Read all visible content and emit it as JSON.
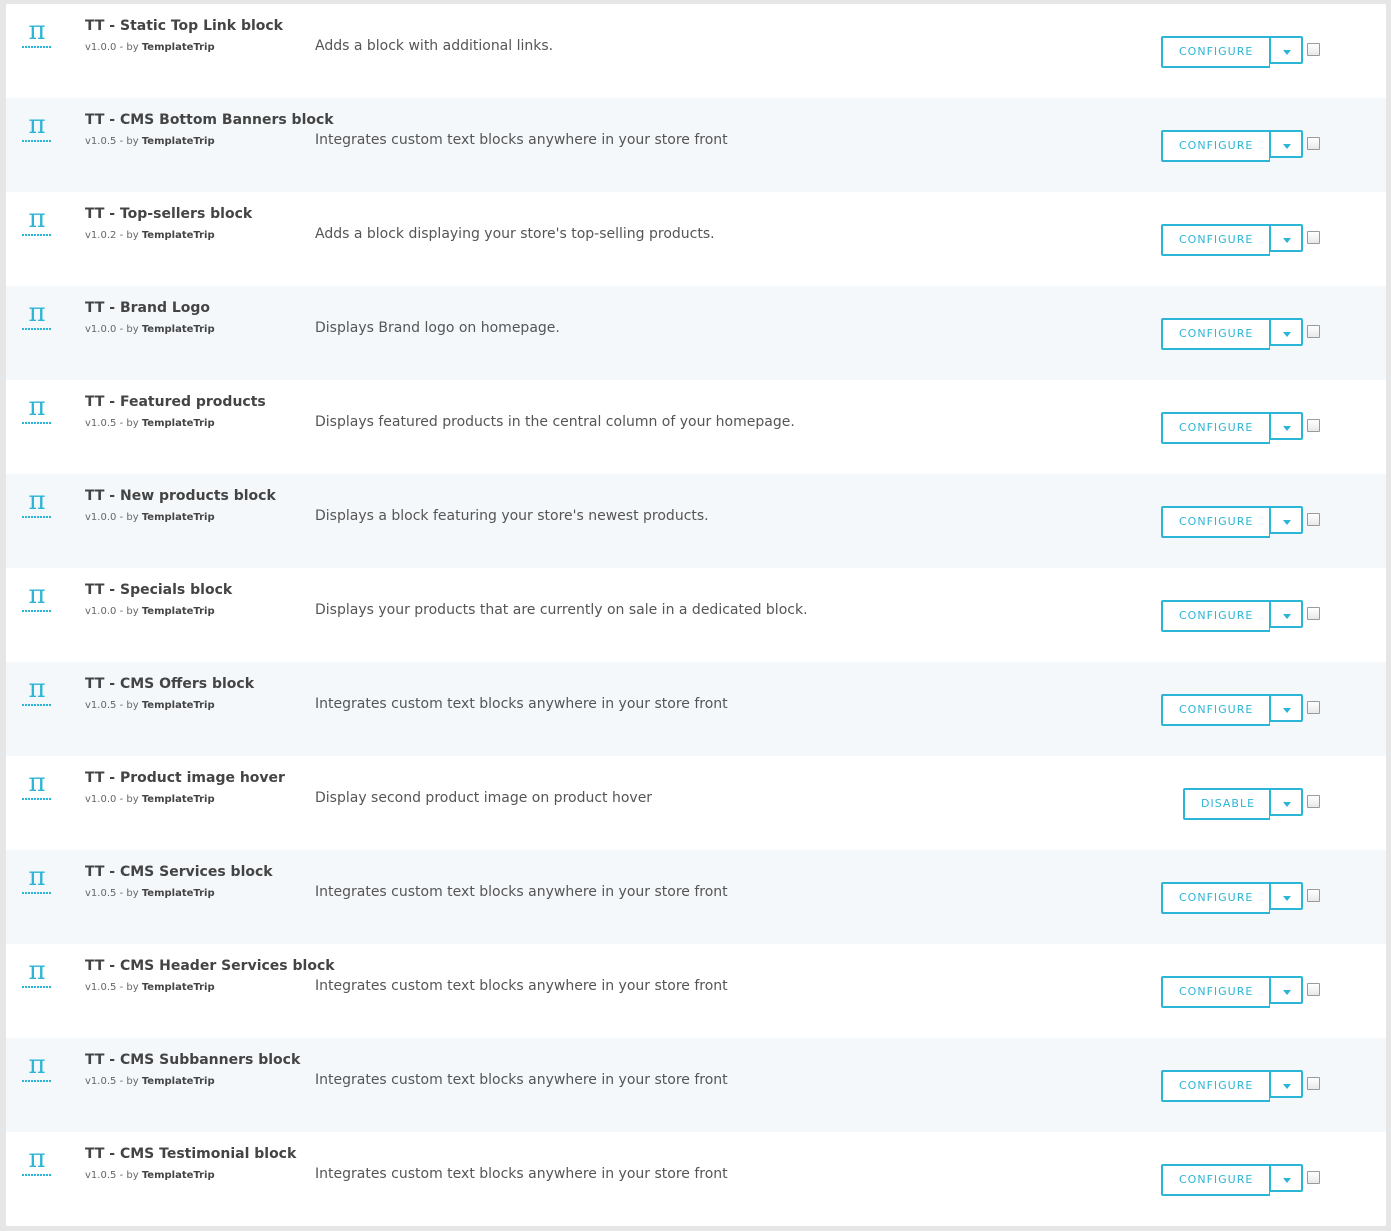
{
  "modules": [
    {
      "title": "TT - Static Top Link block",
      "version": "v1.0.0",
      "by": "- by",
      "author": "TemplateTrip",
      "description": "Adds a block with additional links.",
      "action": "CONFIGURE"
    },
    {
      "title": "TT - CMS Bottom Banners block",
      "version": "v1.0.5",
      "by": "- by",
      "author": "TemplateTrip",
      "description": "Integrates custom text blocks anywhere in your store front",
      "action": "CONFIGURE"
    },
    {
      "title": "TT - Top-sellers block",
      "version": "v1.0.2",
      "by": "- by",
      "author": "TemplateTrip",
      "description": "Adds a block displaying your store's top-selling products.",
      "action": "CONFIGURE"
    },
    {
      "title": "TT - Brand Logo",
      "version": "v1.0.0",
      "by": "- by",
      "author": "TemplateTrip",
      "description": "Displays Brand logo on homepage.",
      "action": "CONFIGURE"
    },
    {
      "title": "TT - Featured products",
      "version": "v1.0.5",
      "by": "- by",
      "author": "TemplateTrip",
      "description": "Displays featured products in the central column of your homepage.",
      "action": "CONFIGURE"
    },
    {
      "title": "TT - New products block",
      "version": "v1.0.0",
      "by": "- by",
      "author": "TemplateTrip",
      "description": "Displays a block featuring your store's newest products.",
      "action": "CONFIGURE"
    },
    {
      "title": "TT - Specials block",
      "version": "v1.0.0",
      "by": "- by",
      "author": "TemplateTrip",
      "description": "Displays your products that are currently on sale in a dedicated block.",
      "action": "CONFIGURE"
    },
    {
      "title": "TT - CMS Offers block",
      "version": "v1.0.5",
      "by": "- by",
      "author": "TemplateTrip",
      "description": "Integrates custom text blocks anywhere in your store front",
      "action": "CONFIGURE"
    },
    {
      "title": "TT - Product image hover",
      "version": "v1.0.0",
      "by": "- by",
      "author": "TemplateTrip",
      "description": "Display second product image on product hover",
      "action": "DISABLE"
    },
    {
      "title": "TT - CMS Services block",
      "version": "v1.0.5",
      "by": "- by",
      "author": "TemplateTrip",
      "description": "Integrates custom text blocks anywhere in your store front",
      "action": "CONFIGURE"
    },
    {
      "title": "TT - CMS Header Services block",
      "version": "v1.0.5",
      "by": "- by",
      "author": "TemplateTrip",
      "description": "Integrates custom text blocks anywhere in your store front",
      "action": "CONFIGURE"
    },
    {
      "title": "TT - CMS Subbanners block",
      "version": "v1.0.5",
      "by": "- by",
      "author": "TemplateTrip",
      "description": "Integrates custom text blocks anywhere in your store front",
      "action": "CONFIGURE"
    },
    {
      "title": "TT - CMS Testimonial block",
      "version": "v1.0.5",
      "by": "- by",
      "author": "TemplateTrip",
      "description": "Integrates custom text blocks anywhere in your store front",
      "action": "CONFIGURE"
    }
  ],
  "logo_glyph": "π",
  "logo_icon": "templatetrip-logo-icon",
  "accent_color": "#2bb5d6"
}
